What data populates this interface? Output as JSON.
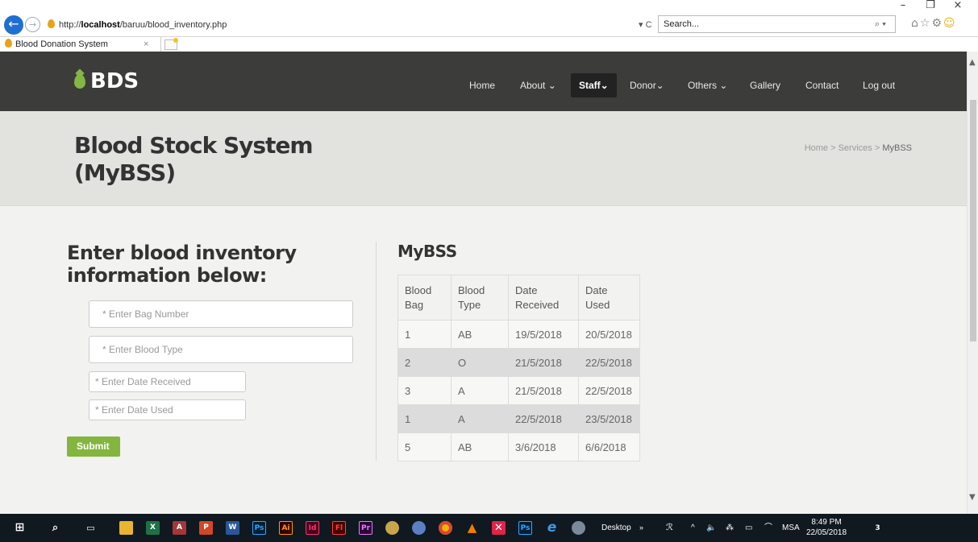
{
  "browser": {
    "url_prefix": "http://",
    "url_host": "localhost",
    "url_path": "/baruu/blood_inventory.php",
    "url_controls": "▾ C",
    "search_placeholder": "Search...",
    "search_controls": "⌕ ▾",
    "tab_title": "Blood Donation System",
    "tab_close": "×",
    "window_minimize": "–",
    "window_restore": "❐",
    "window_close": "×",
    "home_icon": "⌂",
    "favorites_icon": "☆",
    "settings_icon": "⚙",
    "smile_icon": "☺"
  },
  "site": {
    "logo_text": "BDS",
    "nav": [
      {
        "label": "Home"
      },
      {
        "label": "About ⌄"
      },
      {
        "label": "Staff⌄"
      },
      {
        "label": "Donor⌄"
      },
      {
        "label": "Others ⌄"
      },
      {
        "label": "Gallery"
      },
      {
        "label": "Contact"
      },
      {
        "label": "Log out"
      }
    ],
    "page_title": "Blood Stock System (MyBSS)",
    "breadcrumb": {
      "home": "Home",
      "sep1": " > ",
      "services": "Services",
      "sep2": " > ",
      "current": "MyBSS"
    }
  },
  "form": {
    "heading": "Enter blood inventory information below:",
    "bag_number_placeholder": "* Enter Bag Number",
    "blood_type_placeholder": "* Enter Blood Type",
    "date_received_placeholder": "* Enter Date Received",
    "date_used_placeholder": "* Enter Date Used",
    "submit_label": "Submit"
  },
  "table": {
    "heading": "MyBSS",
    "headers": [
      "Blood Bag",
      "Blood Type",
      "Date Received",
      "Date Used"
    ],
    "rows": [
      [
        "1",
        "AB",
        "19/5/2018",
        "20/5/2018"
      ],
      [
        "2",
        "O",
        "21/5/2018",
        "22/5/2018"
      ],
      [
        "3",
        "A",
        "21/5/2018",
        "22/5/2018"
      ],
      [
        "1",
        "A",
        "22/5/2018",
        "23/5/2018"
      ],
      [
        "5",
        "AB",
        "3/6/2018",
        "6/6/2018"
      ]
    ]
  },
  "taskbar": {
    "desktop_label": "Desktop",
    "language": "MSA",
    "time": "8:49 PM",
    "date": "22/05/2018",
    "notification_count": "3",
    "apps": [
      "X",
      "A",
      "P",
      "W",
      "Ps",
      "Ai",
      "Id",
      "Fl",
      "Pr"
    ]
  }
}
